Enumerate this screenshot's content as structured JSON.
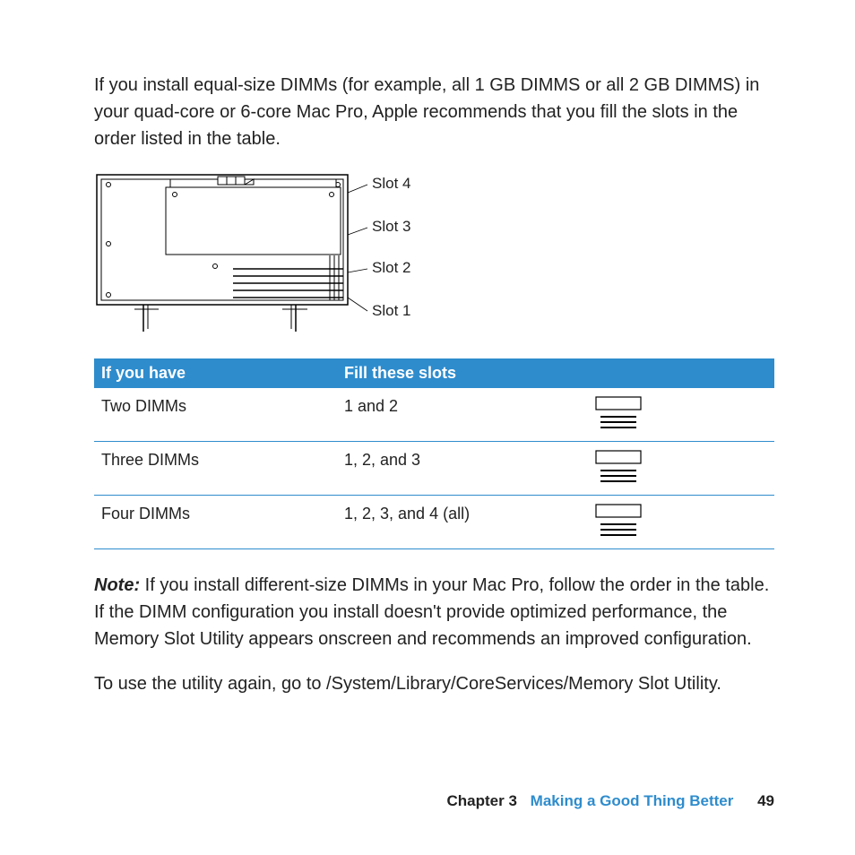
{
  "intro": "If you install equal-size DIMMs (for example, all 1 GB DIMMS or all 2 GB DIMMS) in your quad-core or 6-core Mac Pro, Apple recommends that you fill the slots in the order listed in the table.",
  "diagram": {
    "labels": [
      "Slot 4",
      "Slot 3",
      "Slot 2",
      "Slot 1"
    ]
  },
  "table": {
    "headers": {
      "col1": "If you have",
      "col2": "Fill these slots"
    },
    "rows": [
      {
        "col1": "Two DIMMs",
        "col2": "1 and 2"
      },
      {
        "col1": "Three DIMMs",
        "col2": "1, 2, and 3"
      },
      {
        "col1": "Four DIMMs",
        "col2": "1, 2, 3, and 4 (all)"
      }
    ]
  },
  "note_label": "Note:",
  "note_body": "  If you install different-size DIMMs in your Mac Pro, follow the order in the table. If the DIMM configuration you install doesn't provide optimized performance, the Memory Slot Utility appears onscreen and recommends an improved configuration.",
  "utility_path": "To use the utility again, go to /System/Library/CoreServices/Memory Slot Utility.",
  "footer": {
    "chapter": "Chapter 3",
    "chapter_title": "Making a Good Thing Better",
    "page": "49"
  }
}
